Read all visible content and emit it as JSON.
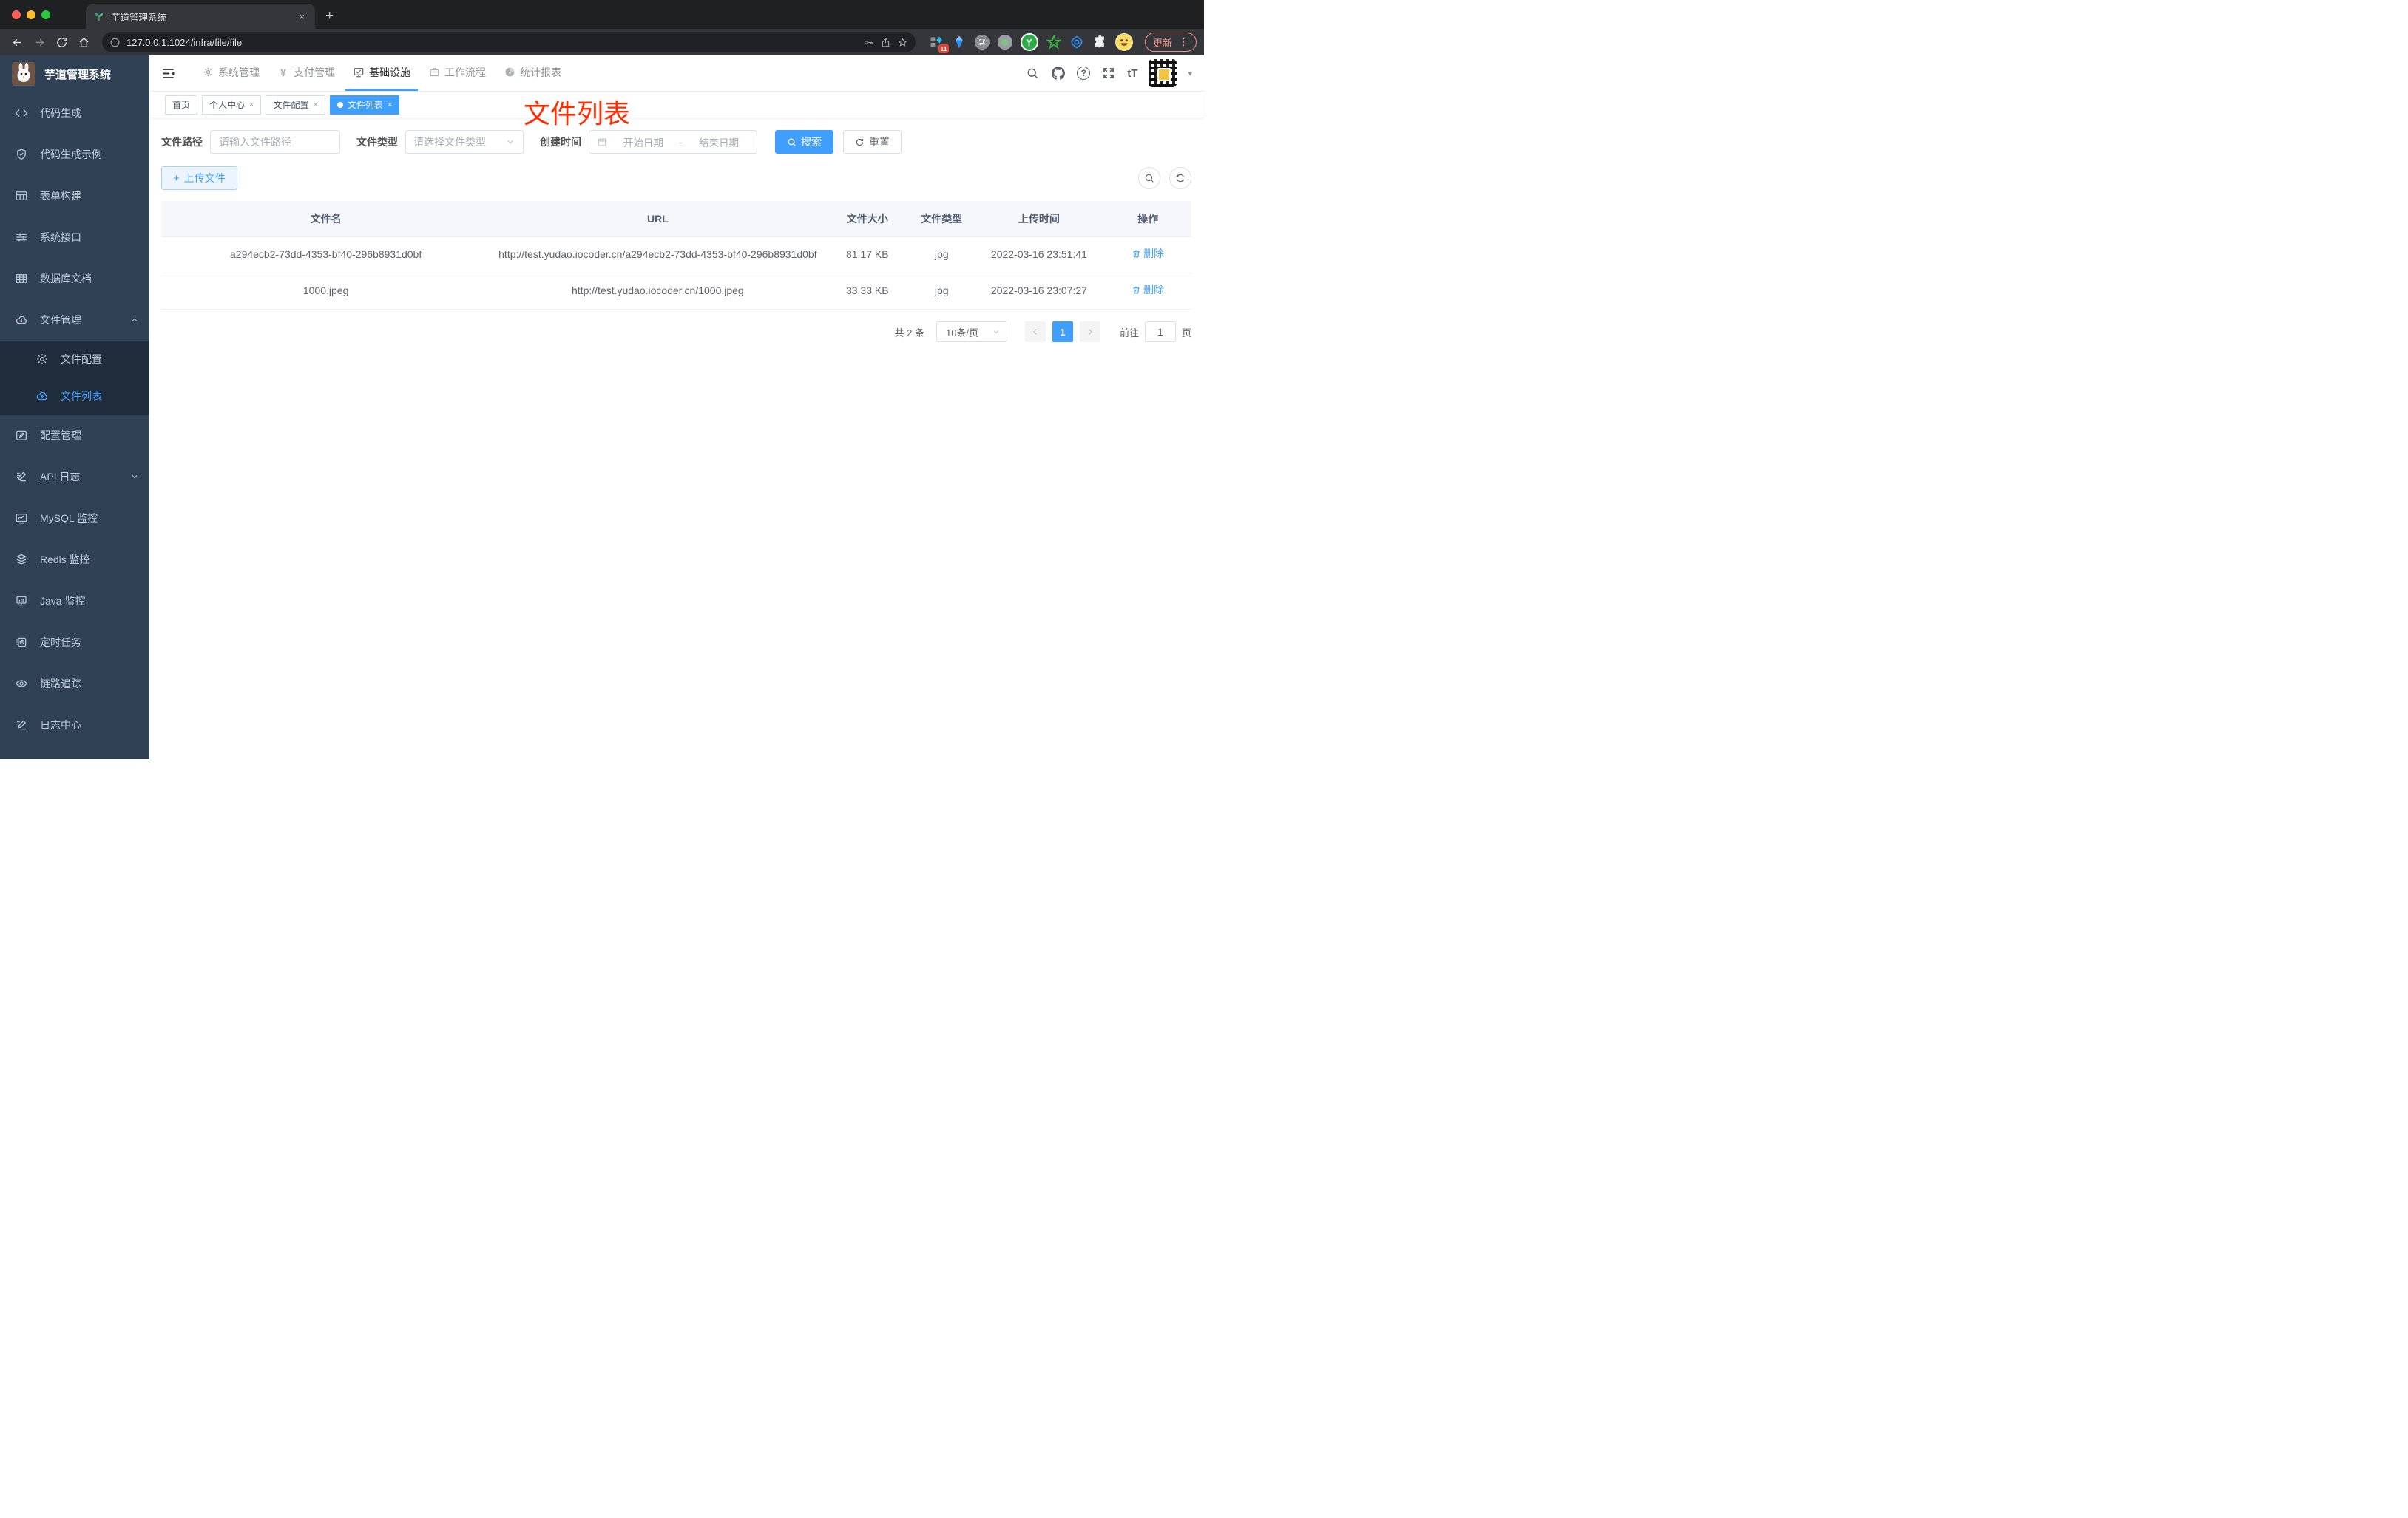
{
  "browser": {
    "tab_title": "芋道管理系统",
    "url": "127.0.0.1:1024/infra/file/file",
    "update_label": "更新",
    "extension_badge": "11"
  },
  "icons": {
    "close": "×",
    "plus": "+",
    "yen": "¥",
    "question": "?",
    "font_size": "tT",
    "dots": "⋮",
    "caret": "▾",
    "newtab": "+"
  },
  "app_title": "芋道管理系统",
  "sidebar": {
    "items": [
      {
        "label": "代码生成"
      },
      {
        "label": "代码生成示例"
      },
      {
        "label": "表单构建"
      },
      {
        "label": "系统接口"
      },
      {
        "label": "数据库文档"
      },
      {
        "label": "文件管理"
      },
      {
        "label": "文件配置"
      },
      {
        "label": "文件列表"
      },
      {
        "label": "配置管理"
      },
      {
        "label": "API 日志"
      },
      {
        "label": "MySQL 监控"
      },
      {
        "label": "Redis 监控"
      },
      {
        "label": "Java 监控"
      },
      {
        "label": "定时任务"
      },
      {
        "label": "链路追踪"
      },
      {
        "label": "日志中心"
      }
    ]
  },
  "topnav": {
    "items": [
      {
        "label": "系统管理"
      },
      {
        "label": "支付管理"
      },
      {
        "label": "基础设施",
        "active": true
      },
      {
        "label": "工作流程"
      },
      {
        "label": "统计报表"
      }
    ]
  },
  "tags": [
    {
      "label": "首页"
    },
    {
      "label": "个人中心"
    },
    {
      "label": "文件配置"
    },
    {
      "label": "文件列表",
      "active": true
    }
  ],
  "annotation": "文件列表",
  "filter": {
    "path_label": "文件路径",
    "path_placeholder": "请输入文件路径",
    "type_label": "文件类型",
    "type_placeholder": "请选择文件类型",
    "date_label": "创建时间",
    "date_start": "开始日期",
    "date_sep": "-",
    "date_end": "结束日期",
    "search_label": "搜索",
    "reset_label": "重置"
  },
  "toolbar": {
    "upload_label": "上传文件"
  },
  "table": {
    "headers": [
      "文件名",
      "URL",
      "文件大小",
      "文件类型",
      "上传时间",
      "操作"
    ],
    "rows": [
      {
        "name": "a294ecb2-73dd-4353-bf40-296b8931d0bf",
        "url": "http://test.yudao.iocoder.cn/a294ecb2-73dd-4353-bf40-296b8931d0bf",
        "size": "81.17 KB",
        "type": "jpg",
        "time": "2022-03-16 23:51:41",
        "action": "删除"
      },
      {
        "name": "1000.jpeg",
        "url": "http://test.yudao.iocoder.cn/1000.jpeg",
        "size": "33.33 KB",
        "type": "jpg",
        "time": "2022-03-16 23:07:27",
        "action": "删除"
      }
    ]
  },
  "pagination": {
    "total": "共 2 条",
    "page_size": "10条/页",
    "current_page": "1",
    "goto_label": "前往",
    "goto_value": "1",
    "page_unit": "页"
  },
  "colors": {
    "accent": "#409eff",
    "annotation_red": "#ff2c00",
    "sidebar_bg": "#304156",
    "submenu_bg": "#1f2d3d"
  }
}
